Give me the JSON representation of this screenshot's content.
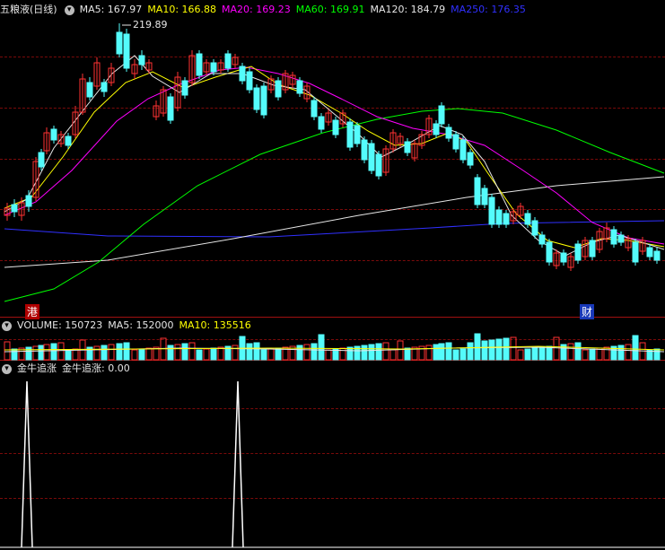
{
  "main_panel": {
    "stock_name": "五粮液(日线)",
    "settings_icon": "chevron-down-icon",
    "ma_labels": [
      {
        "text": "MA5: 167.97",
        "color": "#e6e6e6"
      },
      {
        "text": "MA10: 166.88",
        "color": "#ffff00"
      },
      {
        "text": "MA20: 169.23",
        "color": "#ff00ff"
      },
      {
        "text": "MA60: 169.91",
        "color": "#00ff00"
      },
      {
        "text": "MA120: 184.79",
        "color": "#e6e6e6"
      },
      {
        "text": "MA250: 176.35",
        "color": "#3030ff"
      }
    ],
    "peak_label": "219.89",
    "event_markers": [
      "港",
      "财"
    ]
  },
  "volume_panel": {
    "labels": [
      {
        "text": "VOLUME: 150723",
        "color": "#e6e6e6"
      },
      {
        "text": "MA5: 152000",
        "color": "#e6e6e6"
      },
      {
        "text": "MA10: 135516",
        "color": "#ffff00"
      }
    ]
  },
  "indicator_panel": {
    "name": "金牛追涨",
    "value_label": "金牛追涨: 0.00",
    "spike_positions": [
      1,
      0
    ]
  },
  "colors": {
    "up": "#ff3232",
    "down": "#54fcfc",
    "ma5": "#e6e6e6",
    "ma10": "#ffff00",
    "ma20": "#ff00ff",
    "ma60": "#00ff00",
    "ma120": "#e6e6e6",
    "ma250": "#3030ff",
    "grid": "#7a0a0a"
  }
}
